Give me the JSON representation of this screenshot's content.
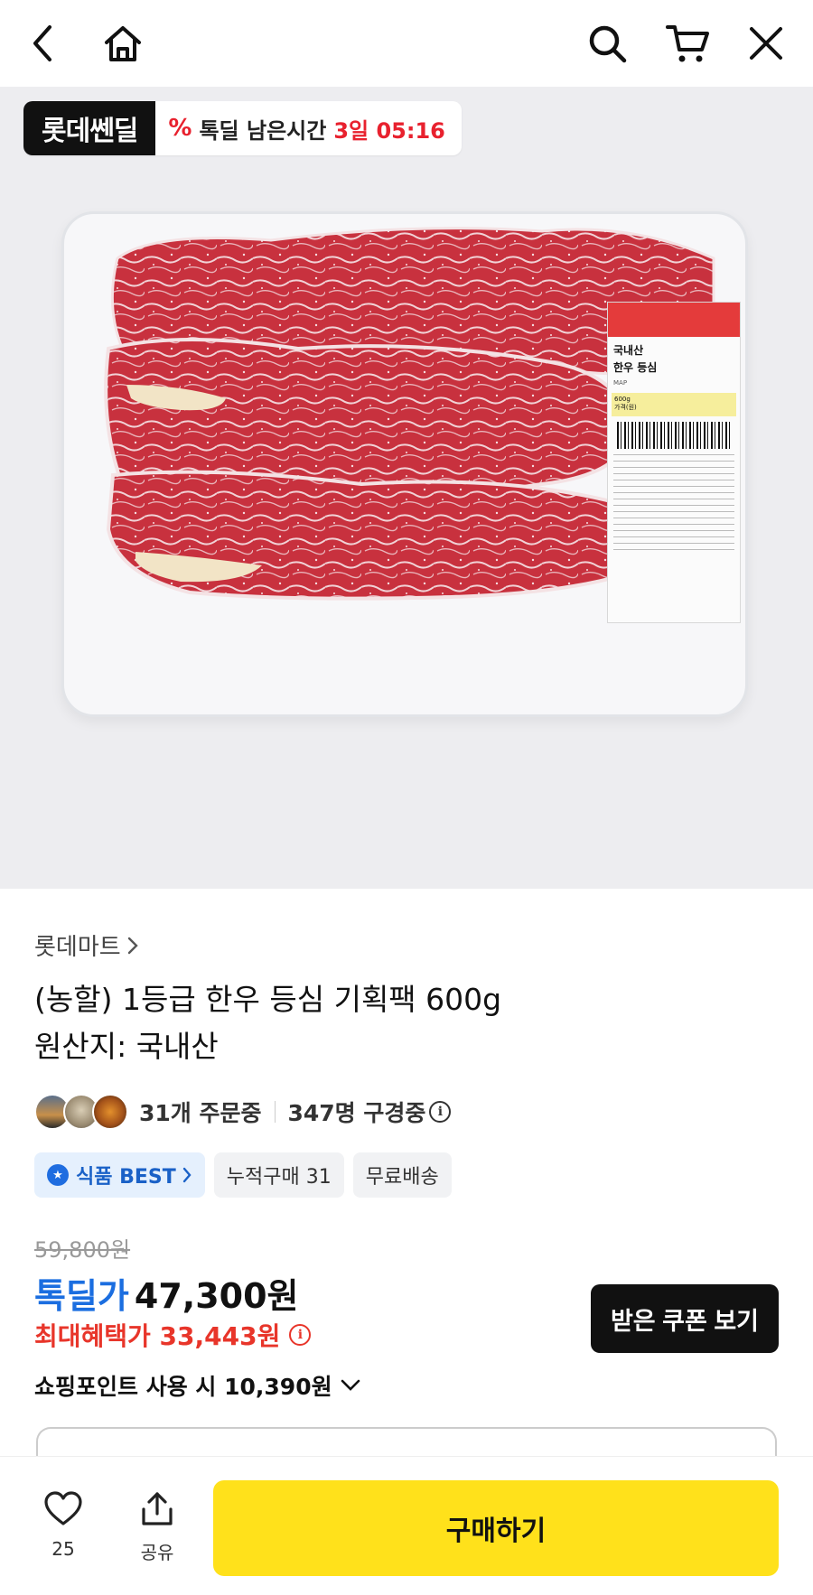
{
  "header": {
    "back_icon": "chevron-left-icon",
    "home_icon": "home-icon",
    "search_icon": "search-icon",
    "cart_icon": "cart-icon",
    "close_icon": "close-icon"
  },
  "hero": {
    "deal_logo": "롯데쎈딜",
    "deal_pct_icon": "%",
    "deal_label": "톡딜 남은시간",
    "deal_time": "3일 05:16",
    "product_label": {
      "origin": "국내산",
      "name": "한우 등심",
      "map": "MAP",
      "weight": "600g",
      "price_label": "가격(원)"
    }
  },
  "product": {
    "store": "롯데마트",
    "title": "(농할) 1등급 한우 등심 기획팩 600g",
    "origin_line": "원산지: 국내산",
    "orders": "31개 주문중",
    "viewers": "347명 구경중",
    "chips": {
      "best": "식품 BEST",
      "cumulative": "누적구매 31",
      "shipping": "무료배송"
    },
    "original_price": "59,800원",
    "deal_label": "톡딜가",
    "deal_price": "47,300원",
    "max_benefit": "최대혜택가 33,443원",
    "coupon_button": "받은 쿠폰 보기",
    "point_line": "쇼핑포인트 사용 시 10,390원"
  },
  "bottom": {
    "like_count": "25",
    "share_label": "공유",
    "buy_button": "구매하기"
  },
  "colors": {
    "deal_red": "#e8212e",
    "deal_blue": "#1b6ee0",
    "buy_yellow": "#ffe11b",
    "benefit_red": "#e8352a"
  }
}
